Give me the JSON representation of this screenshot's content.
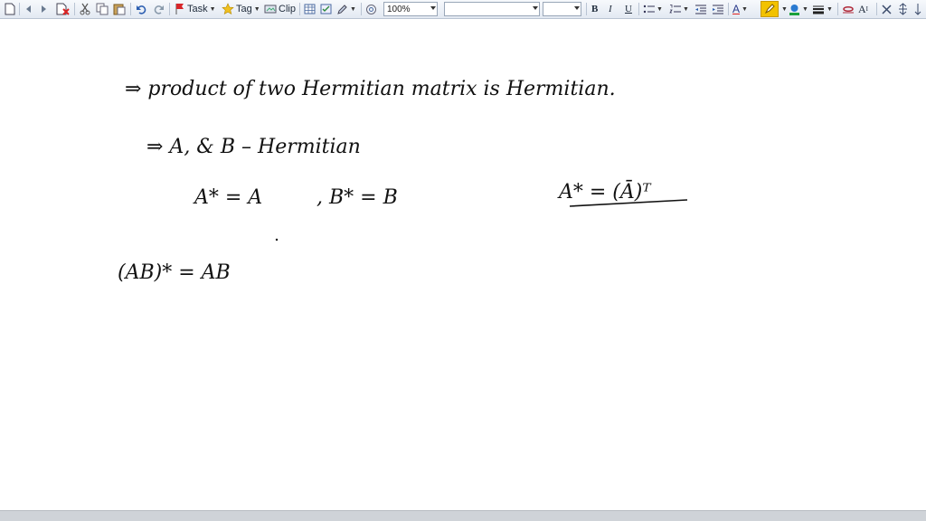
{
  "toolbar": {
    "task_label": "Task",
    "tag_label": "Tag",
    "clip_label": "Clip",
    "zoom_value": "100%",
    "font_name_value": "",
    "font_size_value": "",
    "bold_label": "B",
    "italic_label": "I",
    "underline_label": "U",
    "font_color_label": "A",
    "clear_format_label": "A"
  },
  "note": {
    "line1": "⇒ product of two Hermitian matrix is Hermitian.",
    "line2": "⇒ A, & B – Hermitian",
    "line3a": "A* = A",
    "line3b": ", B* = B",
    "definition": "A* = (Ā)ᵀ",
    "line4": "(AB)* = AB"
  },
  "colors": {
    "toolbar_bg": "#e8edf4",
    "ink": "#111111",
    "highlight": "#f2c200",
    "scrollbar": "#cfd3d8"
  }
}
